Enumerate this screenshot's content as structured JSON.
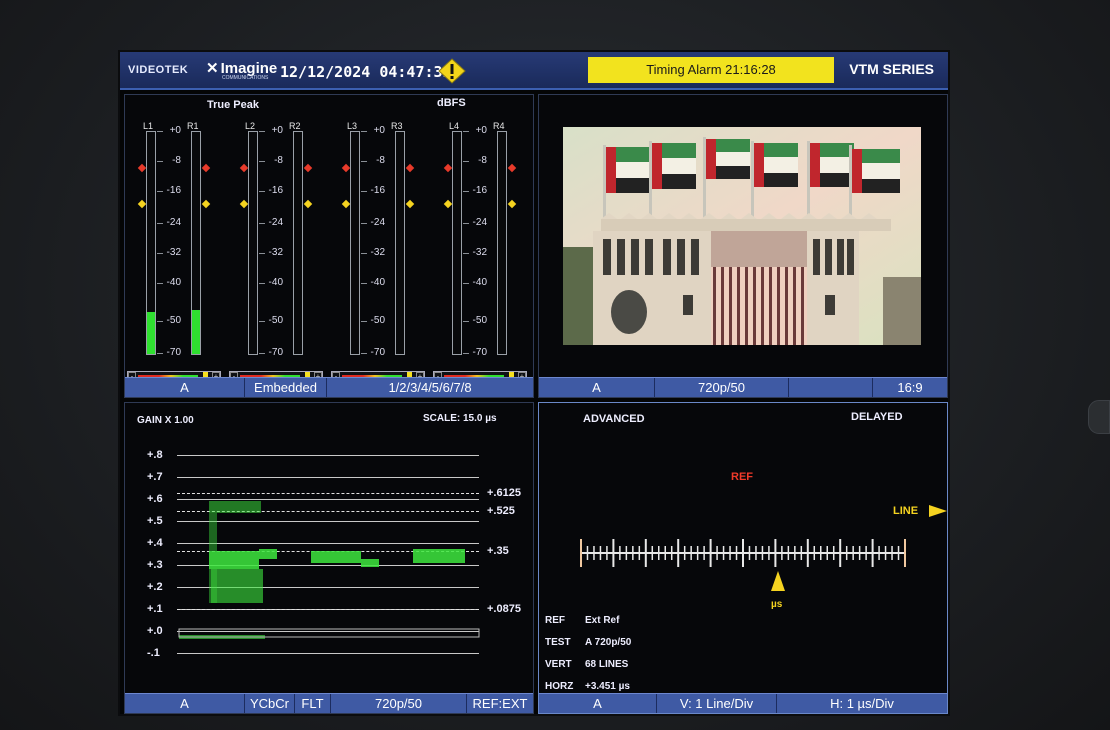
{
  "header": {
    "brand": "VIDEOTEK",
    "logo": "Imagine",
    "logo_sub": "COMMUNICATIONS",
    "datetime": "12/12/2024 04:47:35",
    "alarm": "Timing Alarm 21:16:28",
    "series": "VTM SERIES",
    "warning_icon": "warning-triangle-icon",
    "alarm_color": "#f2e31e"
  },
  "audio": {
    "title_left": "True Peak",
    "title_right": "dBFS",
    "channels": [
      {
        "left": "L1",
        "right": "R1",
        "left_level": 0.19,
        "right_level": 0.2
      },
      {
        "left": "L2",
        "right": "R2",
        "left_level": 0,
        "right_level": 0
      },
      {
        "left": "L3",
        "right": "R3",
        "left_level": 0,
        "right_level": 0
      },
      {
        "left": "L4",
        "right": "R4",
        "left_level": 0,
        "right_level": 0
      }
    ],
    "scale": [
      "+0",
      "-8",
      "-16",
      "-24",
      "-32",
      "-40",
      "-50",
      "-70"
    ],
    "status": [
      "A",
      "Embedded",
      "1/2/3/4/5/6/7/8"
    ]
  },
  "picture": {
    "status": [
      "A",
      "720p/50",
      "",
      "16:9"
    ]
  },
  "waveform": {
    "gain": "GAIN X 1.00",
    "scale": "SCALE: 15.0 µs",
    "y_labels": [
      "+.8",
      "+.7",
      "+.6",
      "+.5",
      "+.4",
      "+.3",
      "+.2",
      "+.1",
      "+.0",
      "-.1"
    ],
    "ref_labels": [
      "+.6125",
      "+.525",
      "+.35",
      "+.0875"
    ],
    "status": [
      "A",
      "YCbCr",
      "FLT",
      "720p/50",
      "REF:EXT"
    ]
  },
  "timing": {
    "mode": "ADVANCED",
    "delayed": "DELAYED",
    "ref_label": "REF",
    "line_label": "LINE",
    "us_label": "µs",
    "info": [
      {
        "key": "REF",
        "value": "Ext Ref"
      },
      {
        "key": "TEST",
        "value": "A 720p/50"
      },
      {
        "key": "VERT",
        "value": "68 LINES"
      },
      {
        "key": "HORZ",
        "value": "+3.451 µs"
      }
    ],
    "status": [
      "A",
      "V: 1 Line/Div",
      "H: 1 µs/Div"
    ]
  }
}
